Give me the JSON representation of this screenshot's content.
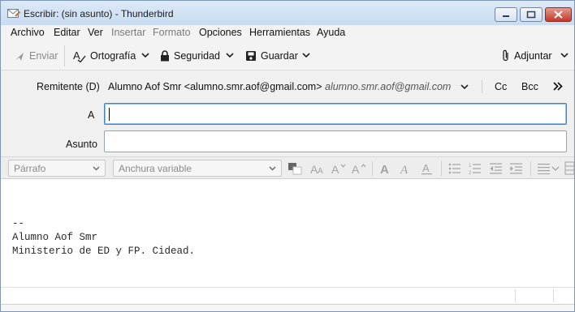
{
  "window": {
    "title": "Escribir: (sin asunto) - Thunderbird",
    "controls": [
      "minimize-icon",
      "maximize-icon",
      "close-icon"
    ]
  },
  "menubar": {
    "items": [
      {
        "label": "Archivo",
        "enabled": true
      },
      {
        "label": "Editar",
        "enabled": true
      },
      {
        "label": "Ver",
        "enabled": true
      },
      {
        "label": "Insertar",
        "enabled": false
      },
      {
        "label": "Formato",
        "enabled": false
      },
      {
        "label": "Opciones",
        "enabled": true
      },
      {
        "label": "Herramientas",
        "enabled": true
      },
      {
        "label": "Ayuda",
        "enabled": true
      }
    ]
  },
  "toolbar": {
    "send_label": "Enviar",
    "spelling_label": "Ortografía",
    "security_label": "Seguridad",
    "save_label": "Guardar",
    "attach_label": "Adjuntar"
  },
  "header": {
    "from_label": "Remitente (D)",
    "from_value": "Alumno Aof Smr <alumno.smr.aof@gmail.com>",
    "from_alias": "alumno.smr.aof@gmail.com",
    "cc_label": "Cc",
    "bcc_label": "Bcc",
    "to_label": "A",
    "to_value": "",
    "subject_label": "Asunto",
    "subject_value": ""
  },
  "format_toolbar": {
    "paragraph_format": "Párrafo",
    "font_family": "Anchura variable"
  },
  "body": {
    "signature_separator": "--",
    "signature_name": "Alumno Aof Smr",
    "signature_org": "Ministerio de ED y FP. Cidead."
  },
  "colors": {
    "accent": "#3d86c6",
    "titlebar": "#c9dcf2",
    "close_button": "#c1382a"
  }
}
